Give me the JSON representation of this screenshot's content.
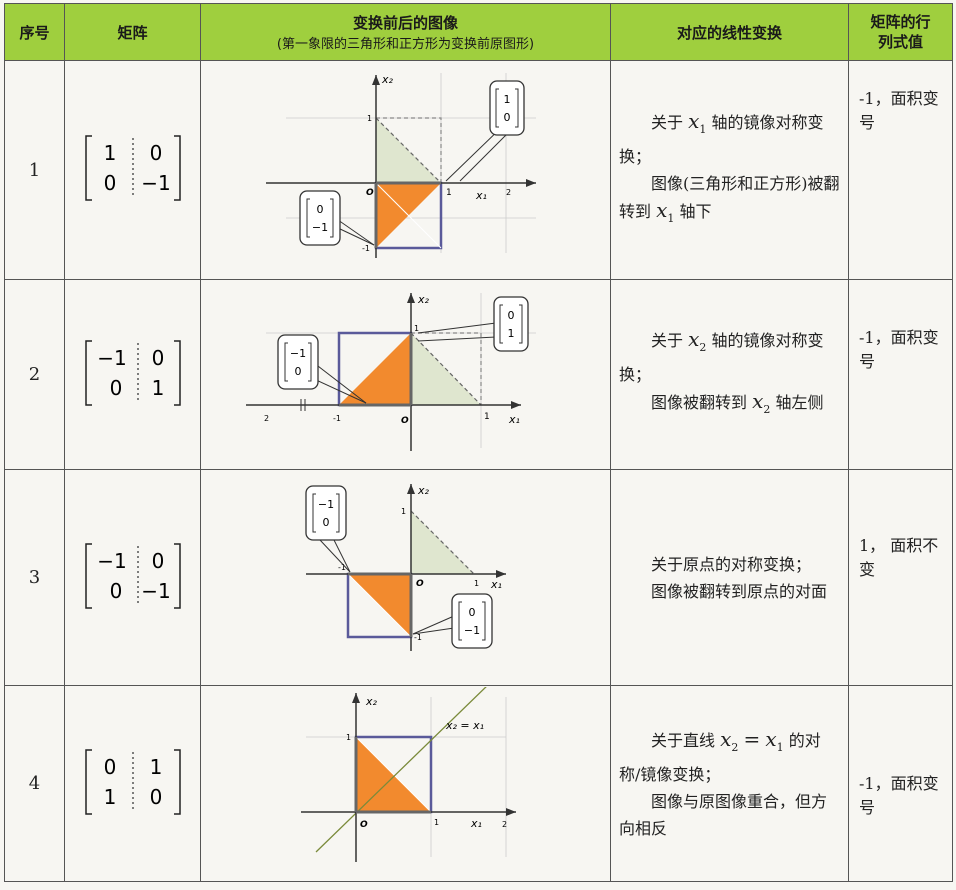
{
  "headers": {
    "num": "序号",
    "matrix": "矩阵",
    "image_title": "变换前后的图像",
    "image_subtitle": "(第一象限的三角形和正方形为变换前原图形)",
    "transform": "对应的线性变换",
    "det_line1": "矩阵的行",
    "det_line2": "列式值"
  },
  "rows": [
    {
      "num": "1",
      "matrix": [
        "1",
        "0",
        "0",
        "−1"
      ],
      "callout_a": [
        "1",
        "0"
      ],
      "callout_b": [
        "0",
        "−1"
      ],
      "desc": {
        "p1_pre": "关于",
        "p1_var": "x",
        "p1_sub": "1",
        "p1_post": "轴的镜像对称变换；",
        "p2_pre": "图像(三角形和正方形)被翻转到",
        "p2_var": "x",
        "p2_sub": "1",
        "p2_post": "轴下"
      },
      "det": "-1，面积变号"
    },
    {
      "num": "2",
      "matrix": [
        "−1",
        "0",
        "0",
        "1"
      ],
      "callout_a": [
        "−1",
        "0"
      ],
      "callout_b": [
        "0",
        "1"
      ],
      "desc": {
        "p1_pre": "关于",
        "p1_var": "x",
        "p1_sub": "2",
        "p1_post": "轴的镜像对称变换；",
        "p2_pre": "图像被翻转到",
        "p2_var": "x",
        "p2_sub": "2",
        "p2_post": "轴左侧"
      },
      "det": "-1，面积变号"
    },
    {
      "num": "3",
      "matrix": [
        "−1",
        "0",
        "0",
        "−1"
      ],
      "callout_a": [
        "−1",
        "0"
      ],
      "callout_b": [
        "0",
        "−1"
      ],
      "desc": {
        "p1": "关于原点的对称变换；",
        "p2": "图像被翻转到原点的对面"
      },
      "det": "1， 面积不变"
    },
    {
      "num": "4",
      "matrix": [
        "0",
        "1",
        "1",
        "0"
      ],
      "line_label": "x₂ = x₁",
      "desc": {
        "p1_pre": "关于直线",
        "p1_var": "x",
        "p1_sub": "2",
        "p1_mid": "=",
        "p1_var2": "x",
        "p1_sub2": "1",
        "p1_post": "的对称/镜像变换；",
        "p2": "图像与原图像重合，但方向相反"
      },
      "det": "-1，面积变号"
    }
  ],
  "axis": {
    "x1": "x₁",
    "x2": "x₂",
    "origin": "O",
    "one": "1",
    "neg_one": "-1",
    "two": "2"
  },
  "colors": {
    "header": "#9fcf3e",
    "orange": "#f28a2e",
    "green_fill": "#dfe6cf",
    "square": "#5a5a9a"
  }
}
